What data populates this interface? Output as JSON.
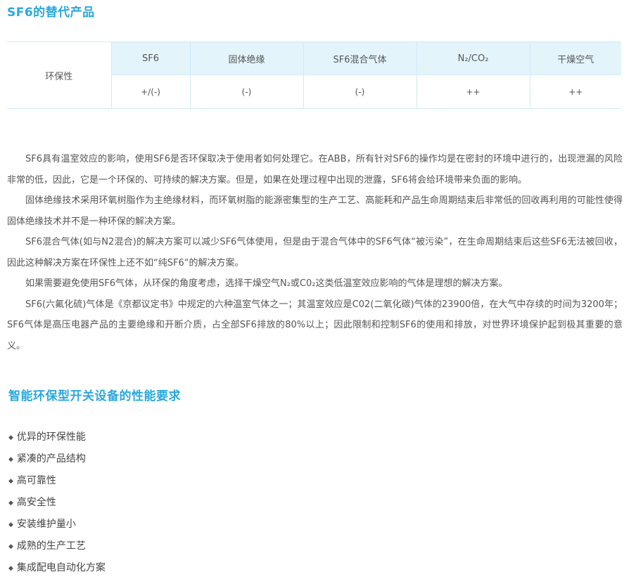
{
  "section1": {
    "title": "SF6的替代产品"
  },
  "table": {
    "row_label": "环保性",
    "headers": [
      "SF6",
      "固体绝缘",
      "SF6混合气体",
      "N₂/CO₂",
      "干燥空气"
    ],
    "values": [
      "+/(-)",
      "(-)",
      "(-)",
      "++",
      "++"
    ]
  },
  "paragraphs": [
    "SF6具有温室效应的影响，使用SF6是否环保取决于使用者如何处理它。在ABB，所有针对SF6的操作均是在密封的环境中进行的，出现泄漏的风险非常的低，因此，它是一个环保的、可持续的解决方案。但是，如果在处理过程中出现的泄露，SF6将会给环境带来负面的影响。",
    "固体绝缘技术采用环氧树脂作为主绝缘材料，而环氧树脂的能源密集型的生产工艺、高能耗和产品生命周期结束后非常低的回收再利用的可能性使得固体绝缘技术并不是一种环保的解决方案。",
    "SF6混合气体(如与N2混合)的解决方案可以减少SF6气体使用，但是由于混合气体中的SF6气体“被污染”，在生命周期结束后这些SF6无法被回收，因此这种解决方案在环保性上还不如“纯SF6“的解决方案。",
    "如果需要避免使用SF6气体，从环保的角度考虑，选择干燥空气N₂或C0₂这类低温室效应影响的气体是理想的解决方案。",
    "SF6(六氟化硫)气体是《京都议定书》中规定的六种温室气体之一；其温室效应是C02(二氧化碳)气体的23900倍，在大气中存续的时间为3200年；SF6气体是高压电器产品的主要绝缘和开断介质，占全部SF6排放的80%以上；因此限制和控制SF6的使用和排放，对世界环境保护起到极其重要的意义。"
  ],
  "section2": {
    "title": "智能环保型开关设备的性能要求",
    "bullet": "◆",
    "items": [
      "优异的环保性能",
      "紧凑的产品结构",
      "高可靠性",
      "高安全性",
      "安装维护量小",
      "成熟的生产工艺",
      "集成配电自动化方案"
    ]
  },
  "colors": {
    "accent": "#2aa8dc",
    "header_bg": "#e4f4fb",
    "border": "#cfe9f6"
  }
}
